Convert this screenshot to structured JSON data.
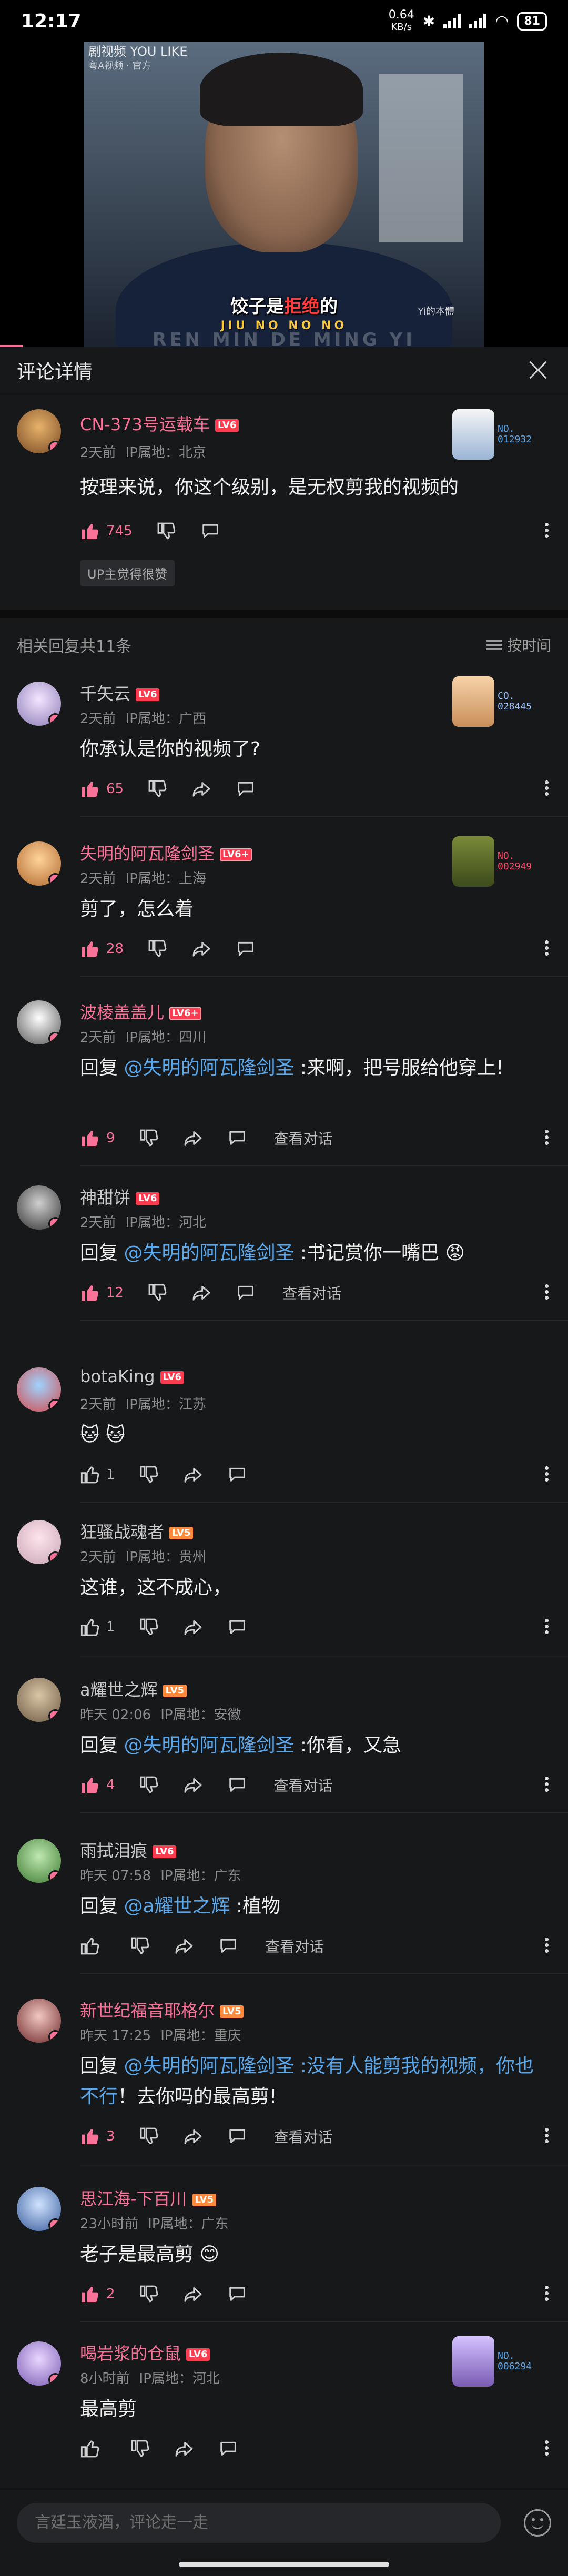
{
  "status_bar": {
    "time": "12:17",
    "net_speed": "0.64",
    "net_unit": "KB/s",
    "battery": "81"
  },
  "video": {
    "watermark_line1": "剧视频 YOU LIKE",
    "watermark_line2": "粤A视频 · 官方",
    "subtitle_pre": "饺子是",
    "subtitle_hot": "拒绝",
    "subtitle_post": "的",
    "subtitle_pinyin": "JIU NO NO NO",
    "watermark_right": "Yi的本體",
    "ghost": "REN MIN DE MING YI",
    "progress_fraction": 0.04
  },
  "header": {
    "title": "评论详情"
  },
  "main_comment": {
    "user": "CN-373号运载车",
    "level": "LV6",
    "time": "2天前",
    "ip": "IP属地：北京",
    "text": "按理来说，你这个级别，是无权剪我的视频的",
    "likes": "745",
    "fan_no_label": "NO.",
    "fan_no": "012932",
    "up_tag": "UP主觉得很赞"
  },
  "related": {
    "label": "相关回复共11条",
    "sort": "按时间"
  },
  "replies": [
    {
      "user": "千矢云",
      "level": "LV6",
      "time": "2天前",
      "ip": "IP属地：广西",
      "text": "你承认是你的视频了?",
      "likes": "65",
      "fan_no_label": "CO.",
      "fan_no": "028445"
    },
    {
      "user": "失明的阿瓦隆剑圣",
      "level": "LV6+",
      "time": "2天前",
      "ip": "IP属地：上海",
      "text": "剪了，怎么着",
      "likes": "28",
      "fan_no_label": "NO.",
      "fan_no": "002949"
    },
    {
      "user": "波棱盖盖儿",
      "level": "LV6+",
      "time": "2天前",
      "ip": "IP属地：四川",
      "reply_prefix": "回复 ",
      "at": "@失明的阿瓦隆剑圣",
      "text": " :来啊，把号服给他穿上!",
      "likes": "9",
      "view_conv": "查看对话"
    },
    {
      "user": "神甜饼",
      "level": "LV6",
      "time": "2天前",
      "ip": "IP属地：河北",
      "reply_prefix": "回复 ",
      "at": "@失明的阿瓦隆剑圣",
      "text": " :书记赏你一嘴巴 😡",
      "likes": "12",
      "view_conv": "查看对话"
    },
    {
      "user": "botaKing",
      "level": "LV6",
      "time": "2天前",
      "ip": "IP属地：江苏",
      "text": "🐱 🐱",
      "likes": "1"
    },
    {
      "user": "狂骚战魂者",
      "level": "LV5",
      "time": "2天前",
      "ip": "IP属地：贵州",
      "text": "这谁，这不成心，",
      "likes": "1"
    },
    {
      "user": "a耀世之辉",
      "level": "LV5",
      "time": "昨天 02:06",
      "ip": "IP属地：安徽",
      "reply_prefix": "回复 ",
      "at": "@失明的阿瓦隆剑圣",
      "text": " :你看，又急",
      "likes": "4",
      "view_conv": "查看对话"
    },
    {
      "user": "雨拭泪痕",
      "level": "LV6",
      "time": "昨天 07:58",
      "ip": "IP属地：广东",
      "reply_prefix": "回复 ",
      "at": "@a耀世之辉",
      "text": " :植物",
      "likes": "",
      "view_conv": "查看对话"
    },
    {
      "user": "新世纪福音耶格尔",
      "level": "LV5",
      "time": "昨天 17:25",
      "ip": "IP属地：重庆",
      "reply_prefix": "回复 ",
      "at": "@失明的阿瓦隆剑圣 :没有人能剪我的视频，你也不行",
      "text": "！去你吗的最高剪!",
      "likes": "3",
      "view_conv": "查看对话"
    },
    {
      "user": "思江海-下百川",
      "level": "LV5",
      "time": "23小时前",
      "ip": "IP属地：广东",
      "text": "老子是最高剪 😊",
      "likes": "2"
    },
    {
      "user": "喝岩浆的仓鼠",
      "level": "LV6",
      "time": "8小时前",
      "ip": "IP属地：河北",
      "text": "最高剪",
      "likes": "",
      "fan_no_label": "NO.",
      "fan_no": "006294"
    }
  ],
  "input": {
    "placeholder": "言廷玉液酒，评论走一走"
  }
}
